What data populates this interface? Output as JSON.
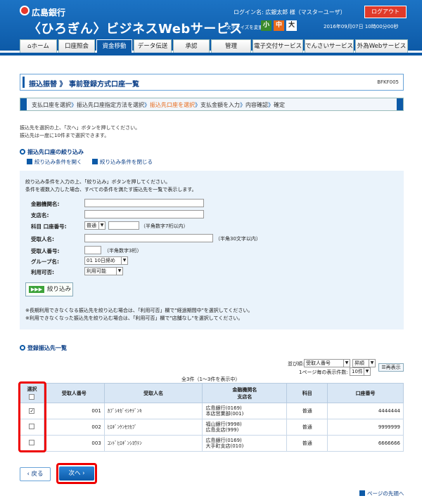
{
  "header": {
    "bank_name": "広島銀行",
    "service_name": "〈ひろぎん〉ビジネスWebサービス",
    "login_info": "ログイン名: 広銀太郎 様（マスターユーザ）",
    "logout_label": "ログアウト",
    "fontsize_label": "文字サイズを変更",
    "font_small": "小",
    "font_mid": "中",
    "font_large": "大",
    "datetime": "2016年09月07日 10時00分00秒"
  },
  "nav": {
    "tabs": [
      "ホーム",
      "口座照会",
      "資金移動",
      "データ伝送",
      "承認",
      "管理",
      "電子交付サービス",
      "でんさいサービス",
      "外為Webサービス"
    ],
    "active": "資金移動"
  },
  "page": {
    "title": "振込振替 》 事前登録方式口座一覧",
    "page_id": "BFKF005"
  },
  "steps": {
    "s1": "支払口座を選択",
    "s2": "振込先口座指定方法を選択",
    "s3": "振込先口座を選択",
    "s4": "支払金額を入力",
    "s5": "内容確認",
    "s6": "確定"
  },
  "instructions": {
    "line1": "振込先を選択の上、「次へ」ボタンを押してください。",
    "line2": "振込先は一度に10件まで選択できます。"
  },
  "filter": {
    "heading": "振込先口座の絞り込み",
    "open_link": "絞り込み条件を開く",
    "close_link": "絞り込み条件を閉じる",
    "desc1": "絞り込み条件を入力の上、「絞り込み」ボタンを押してください。",
    "desc2": "条件を複数入力した場合、すべての条件を満たす振込先を一覧で表示します。",
    "bank_label": "金融機関名:",
    "branch_label": "支店名:",
    "acct_label": "科目 口座番号:",
    "acct_type": "普通",
    "acct_hint": "（半角数字7桁以内）",
    "recipient_label": "受取人名:",
    "recipient_hint": "（半角30文字以内）",
    "recipno_label": "受取人番号:",
    "recipno_hint": "（半角数字3桁）",
    "group_label": "グループ名:",
    "group_value": "01 10日締め",
    "avail_label": "利用可否:",
    "avail_value": "利用可能",
    "button": "絞り込み",
    "note1": "※長期利用できなくなる振込先を絞り込む場合は、「利用可否」欄で\"経過期間中\"を選択してください。",
    "note2": "※利用できなくなった振込先を絞り込む場合は、「利用可否」欄で\"店舗なし\"を選択してください。"
  },
  "list": {
    "heading": "登録振込先一覧",
    "sort_label": "並び順:",
    "sort_value": "受取人番号",
    "order_value": "昇順",
    "perpage_label": "1ページ毎の表示件数:",
    "perpage_value": "10件",
    "redisplay": "再表示",
    "count": "全3件（1～3件を表示中）",
    "headers": {
      "select": "選択",
      "recipno": "受取人番号",
      "recipient": "受取人名",
      "bank": "金融機関名",
      "branch": "支店名",
      "type": "科目",
      "account": "口座番号"
    },
    "rows": [
      {
        "checked": true,
        "no": "001",
        "name": "ｶﾌﾞｼｷｶﾞｲｼﾔﾃﾞﾝｷ",
        "bank": "広島銀行(0169)",
        "branch": "本店営業部(001)",
        "type": "普通",
        "account": "4444444"
      },
      {
        "checked": false,
        "no": "002",
        "name": "ﾋﾛｷﾞﾝｹﾝｾﾂｶﾌﾞ",
        "bank": "福山銀行(9998)",
        "branch": "広島支店(999)",
        "type": "普通",
        "account": "9999999"
      },
      {
        "checked": false,
        "no": "003",
        "name": "ｺﾝﾄﾞﾋﾛｷﾞﾝｼﾖｳﾃﾝ",
        "bank": "広島銀行(0169)",
        "branch": "大手町支店(010)",
        "type": "普通",
        "account": "6666666"
      }
    ]
  },
  "footer": {
    "back": "戻る",
    "next": "次へ",
    "top_link": "ページの先頭へ"
  }
}
